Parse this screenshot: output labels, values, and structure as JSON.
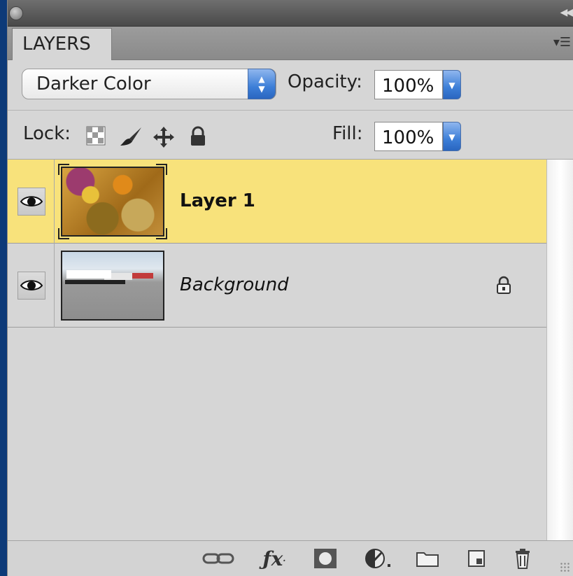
{
  "panel": {
    "tab_label": "LAYERS"
  },
  "blend": {
    "mode": "Darker Color",
    "opacity_label": "Opacity:",
    "opacity_value": "100%"
  },
  "lock": {
    "label": "Lock:",
    "fill_label": "Fill:",
    "fill_value": "100%"
  },
  "layers": [
    {
      "name": "Layer 1",
      "selected": true,
      "visible": true,
      "locked": false
    },
    {
      "name": "Background",
      "selected": false,
      "visible": true,
      "locked": true
    }
  ],
  "colors": {
    "selection": "#f8e27b",
    "accent_blue": "#3d7fd8",
    "panel_bg": "#d6d6d6"
  },
  "footer_icons": [
    "link-layers-icon",
    "fx-icon",
    "layer-mask-icon",
    "adjustment-layer-icon",
    "group-folder-icon",
    "new-layer-icon",
    "trash-icon"
  ]
}
